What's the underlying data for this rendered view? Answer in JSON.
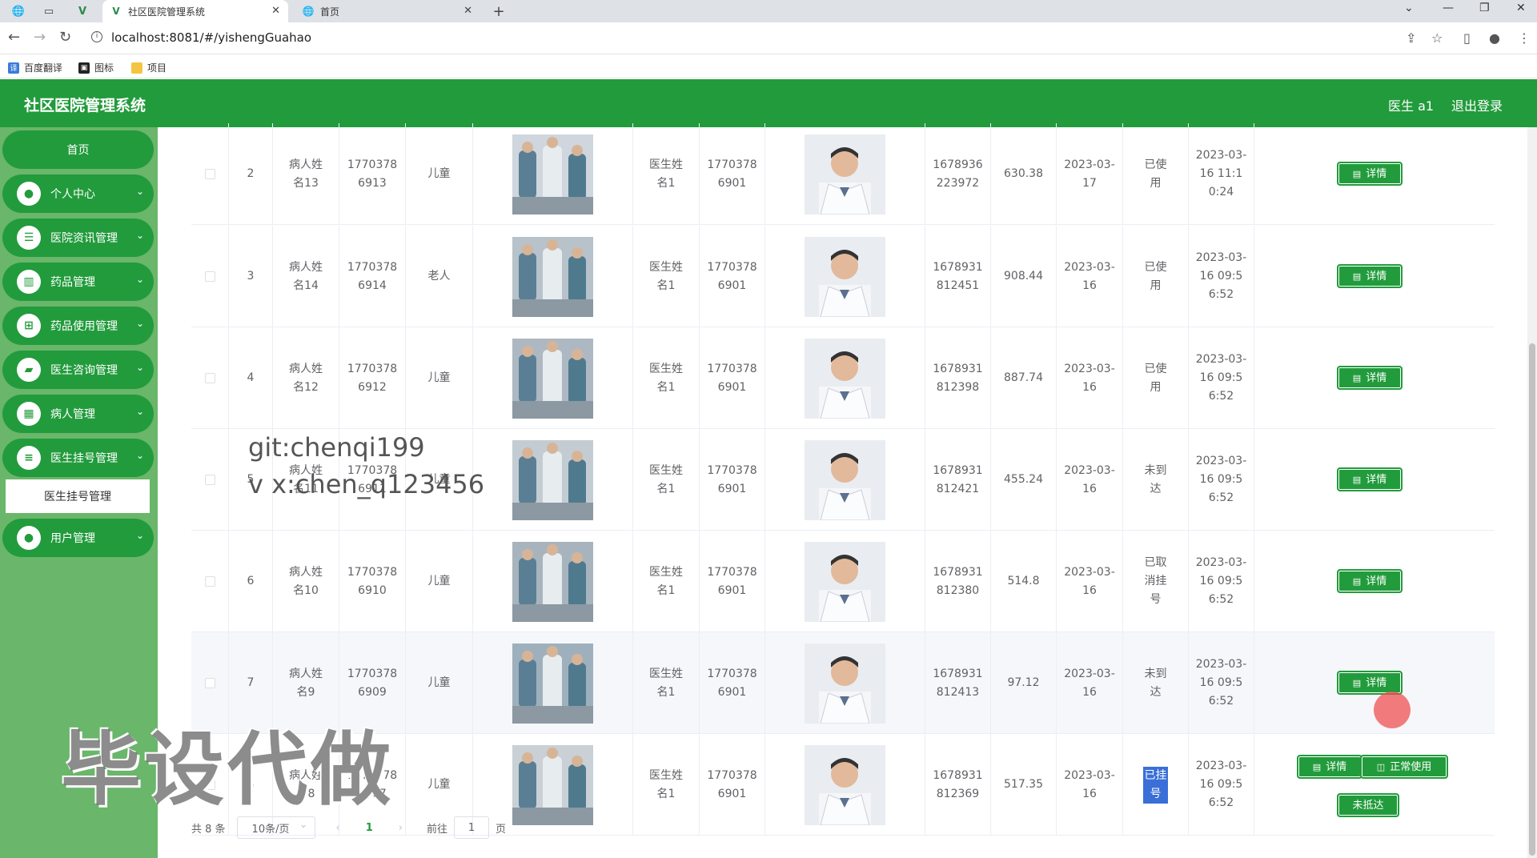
{
  "browser": {
    "tabs": [
      {
        "label": "社区医院管理系统",
        "active": true
      },
      {
        "label": "首页",
        "active": false
      }
    ],
    "url": "localhost:8081/#/yishengGuahao",
    "bookmarks": [
      "百度翻译",
      "图标",
      "项目"
    ]
  },
  "header": {
    "title": "社区医院管理系统",
    "user": "医生 a1",
    "logout": "退出登录"
  },
  "sidebar": {
    "home": "首页",
    "items": [
      {
        "label": "个人中心",
        "icon": "user-icon"
      },
      {
        "label": "医院资讯管理",
        "icon": "news-icon"
      },
      {
        "label": "药品管理",
        "icon": "chart-icon"
      },
      {
        "label": "药品使用管理",
        "icon": "grid-icon"
      },
      {
        "label": "医生咨询管理",
        "icon": "briefcase-icon"
      },
      {
        "label": "病人管理",
        "icon": "apps-icon"
      },
      {
        "label": "医生挂号管理",
        "icon": "list-icon"
      },
      {
        "label": "用户管理",
        "icon": "user-icon"
      }
    ],
    "active_sub": "医生挂号管理"
  },
  "table": {
    "rows": [
      {
        "index": "2",
        "patient_name": "病人姓名13",
        "patient_phone": "17703786913",
        "type": "儿童",
        "doctor_name": "医生姓名1",
        "doctor_phone": "17703786901",
        "order_no": "1678936223972",
        "price": "630.38",
        "date": "2023-03-17",
        "status": "已使用",
        "time": "2023-03-16 11:10:24",
        "detail": "详情"
      },
      {
        "index": "3",
        "patient_name": "病人姓名14",
        "patient_phone": "17703786914",
        "type": "老人",
        "doctor_name": "医生姓名1",
        "doctor_phone": "17703786901",
        "order_no": "1678931812451",
        "price": "908.44",
        "date": "2023-03-16",
        "status": "已使用",
        "time": "2023-03-16 09:56:52",
        "detail": "详情"
      },
      {
        "index": "4",
        "patient_name": "病人姓名12",
        "patient_phone": "17703786912",
        "type": "儿童",
        "doctor_name": "医生姓名1",
        "doctor_phone": "17703786901",
        "order_no": "1678931812398",
        "price": "887.74",
        "date": "2023-03-16",
        "status": "已使用",
        "time": "2023-03-16 09:56:52",
        "detail": "详情"
      },
      {
        "index": "5",
        "patient_name": "病人姓名11",
        "patient_phone": "17703786911",
        "type": "儿童",
        "doctor_name": "医生姓名1",
        "doctor_phone": "17703786901",
        "order_no": "1678931812421",
        "price": "455.24",
        "date": "2023-03-16",
        "status": "未到达",
        "time": "2023-03-16 09:56:52",
        "detail": "详情"
      },
      {
        "index": "6",
        "patient_name": "病人姓名10",
        "patient_phone": "17703786910",
        "type": "儿童",
        "doctor_name": "医生姓名1",
        "doctor_phone": "17703786901",
        "order_no": "1678931812380",
        "price": "514.8",
        "date": "2023-03-16",
        "status": "已取消挂号",
        "time": "2023-03-16 09:56:52",
        "detail": "详情"
      },
      {
        "index": "7",
        "patient_name": "病人姓名9",
        "patient_phone": "17703786909",
        "type": "儿童",
        "doctor_name": "医生姓名1",
        "doctor_phone": "17703786901",
        "order_no": "1678931812413",
        "price": "97.12",
        "date": "2023-03-16",
        "status": "未到达",
        "time": "2023-03-16 09:56:52",
        "detail": "详情"
      },
      {
        "index": "8",
        "patient_name": "病人姓名8",
        "patient_phone": "17703786907",
        "type": "儿童",
        "doctor_name": "医生姓名1",
        "doctor_phone": "17703786901",
        "order_no": "1678931812369",
        "price": "517.35",
        "date": "2023-03-16",
        "status": "已挂号",
        "time": "2023-03-16 09:56:52",
        "detail": "详情",
        "use_btn": "正常使用",
        "absent_btn": "未抵达"
      }
    ]
  },
  "pagination": {
    "total": "共 8 条",
    "page_size": "10条/页",
    "current": "1",
    "goto": "前往",
    "goto_value": "1",
    "page_unit": "页"
  },
  "watermarks": {
    "line1": "git:chenqi199",
    "line2": "v x:chen_q123456",
    "big": "毕设代做"
  }
}
